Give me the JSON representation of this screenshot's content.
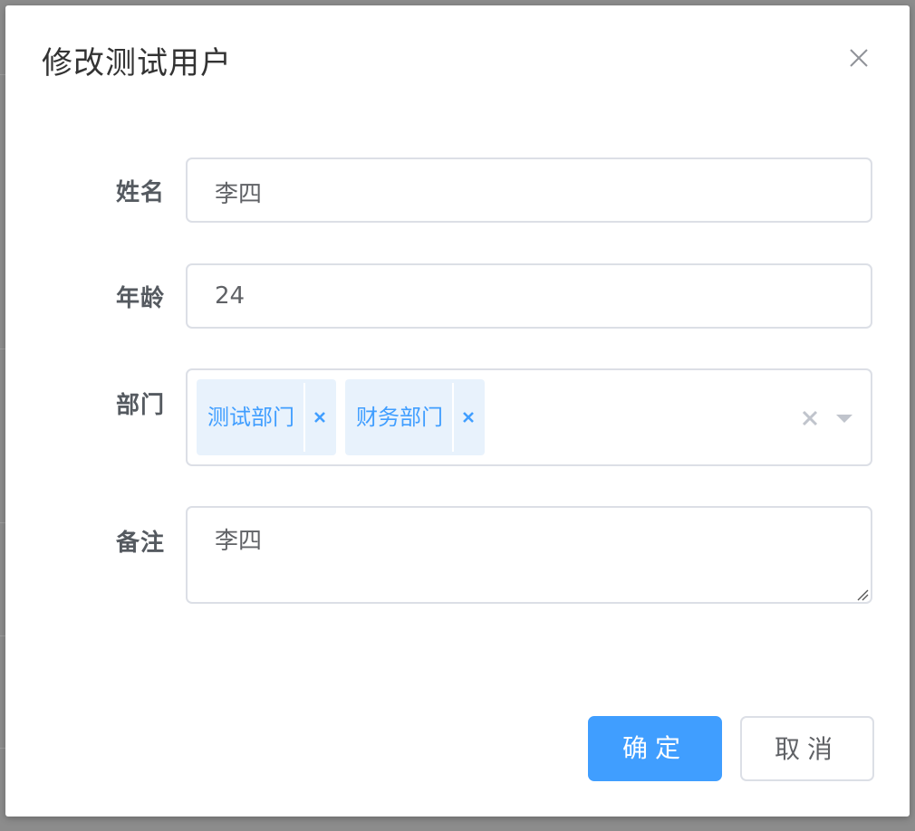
{
  "dialog": {
    "title": "修改测试用户",
    "close_icon": "close-icon"
  },
  "form": {
    "name": {
      "label": "姓名",
      "value": "李四"
    },
    "age": {
      "label": "年龄",
      "value": "24"
    },
    "department": {
      "label": "部门",
      "selected": [
        "测试部门",
        "财务部门"
      ],
      "tag_close_icon": "close-icon",
      "clear_icon": "clear-icon",
      "arrow_icon": "caret-down-icon"
    },
    "remark": {
      "label": "备注",
      "value": "李四"
    }
  },
  "footer": {
    "confirm_label": "确定",
    "cancel_label": "取消"
  },
  "colors": {
    "primary": "#409eff",
    "tag_bg": "#e8f2fc",
    "border": "#dcdfe6",
    "label": "#555a60"
  }
}
